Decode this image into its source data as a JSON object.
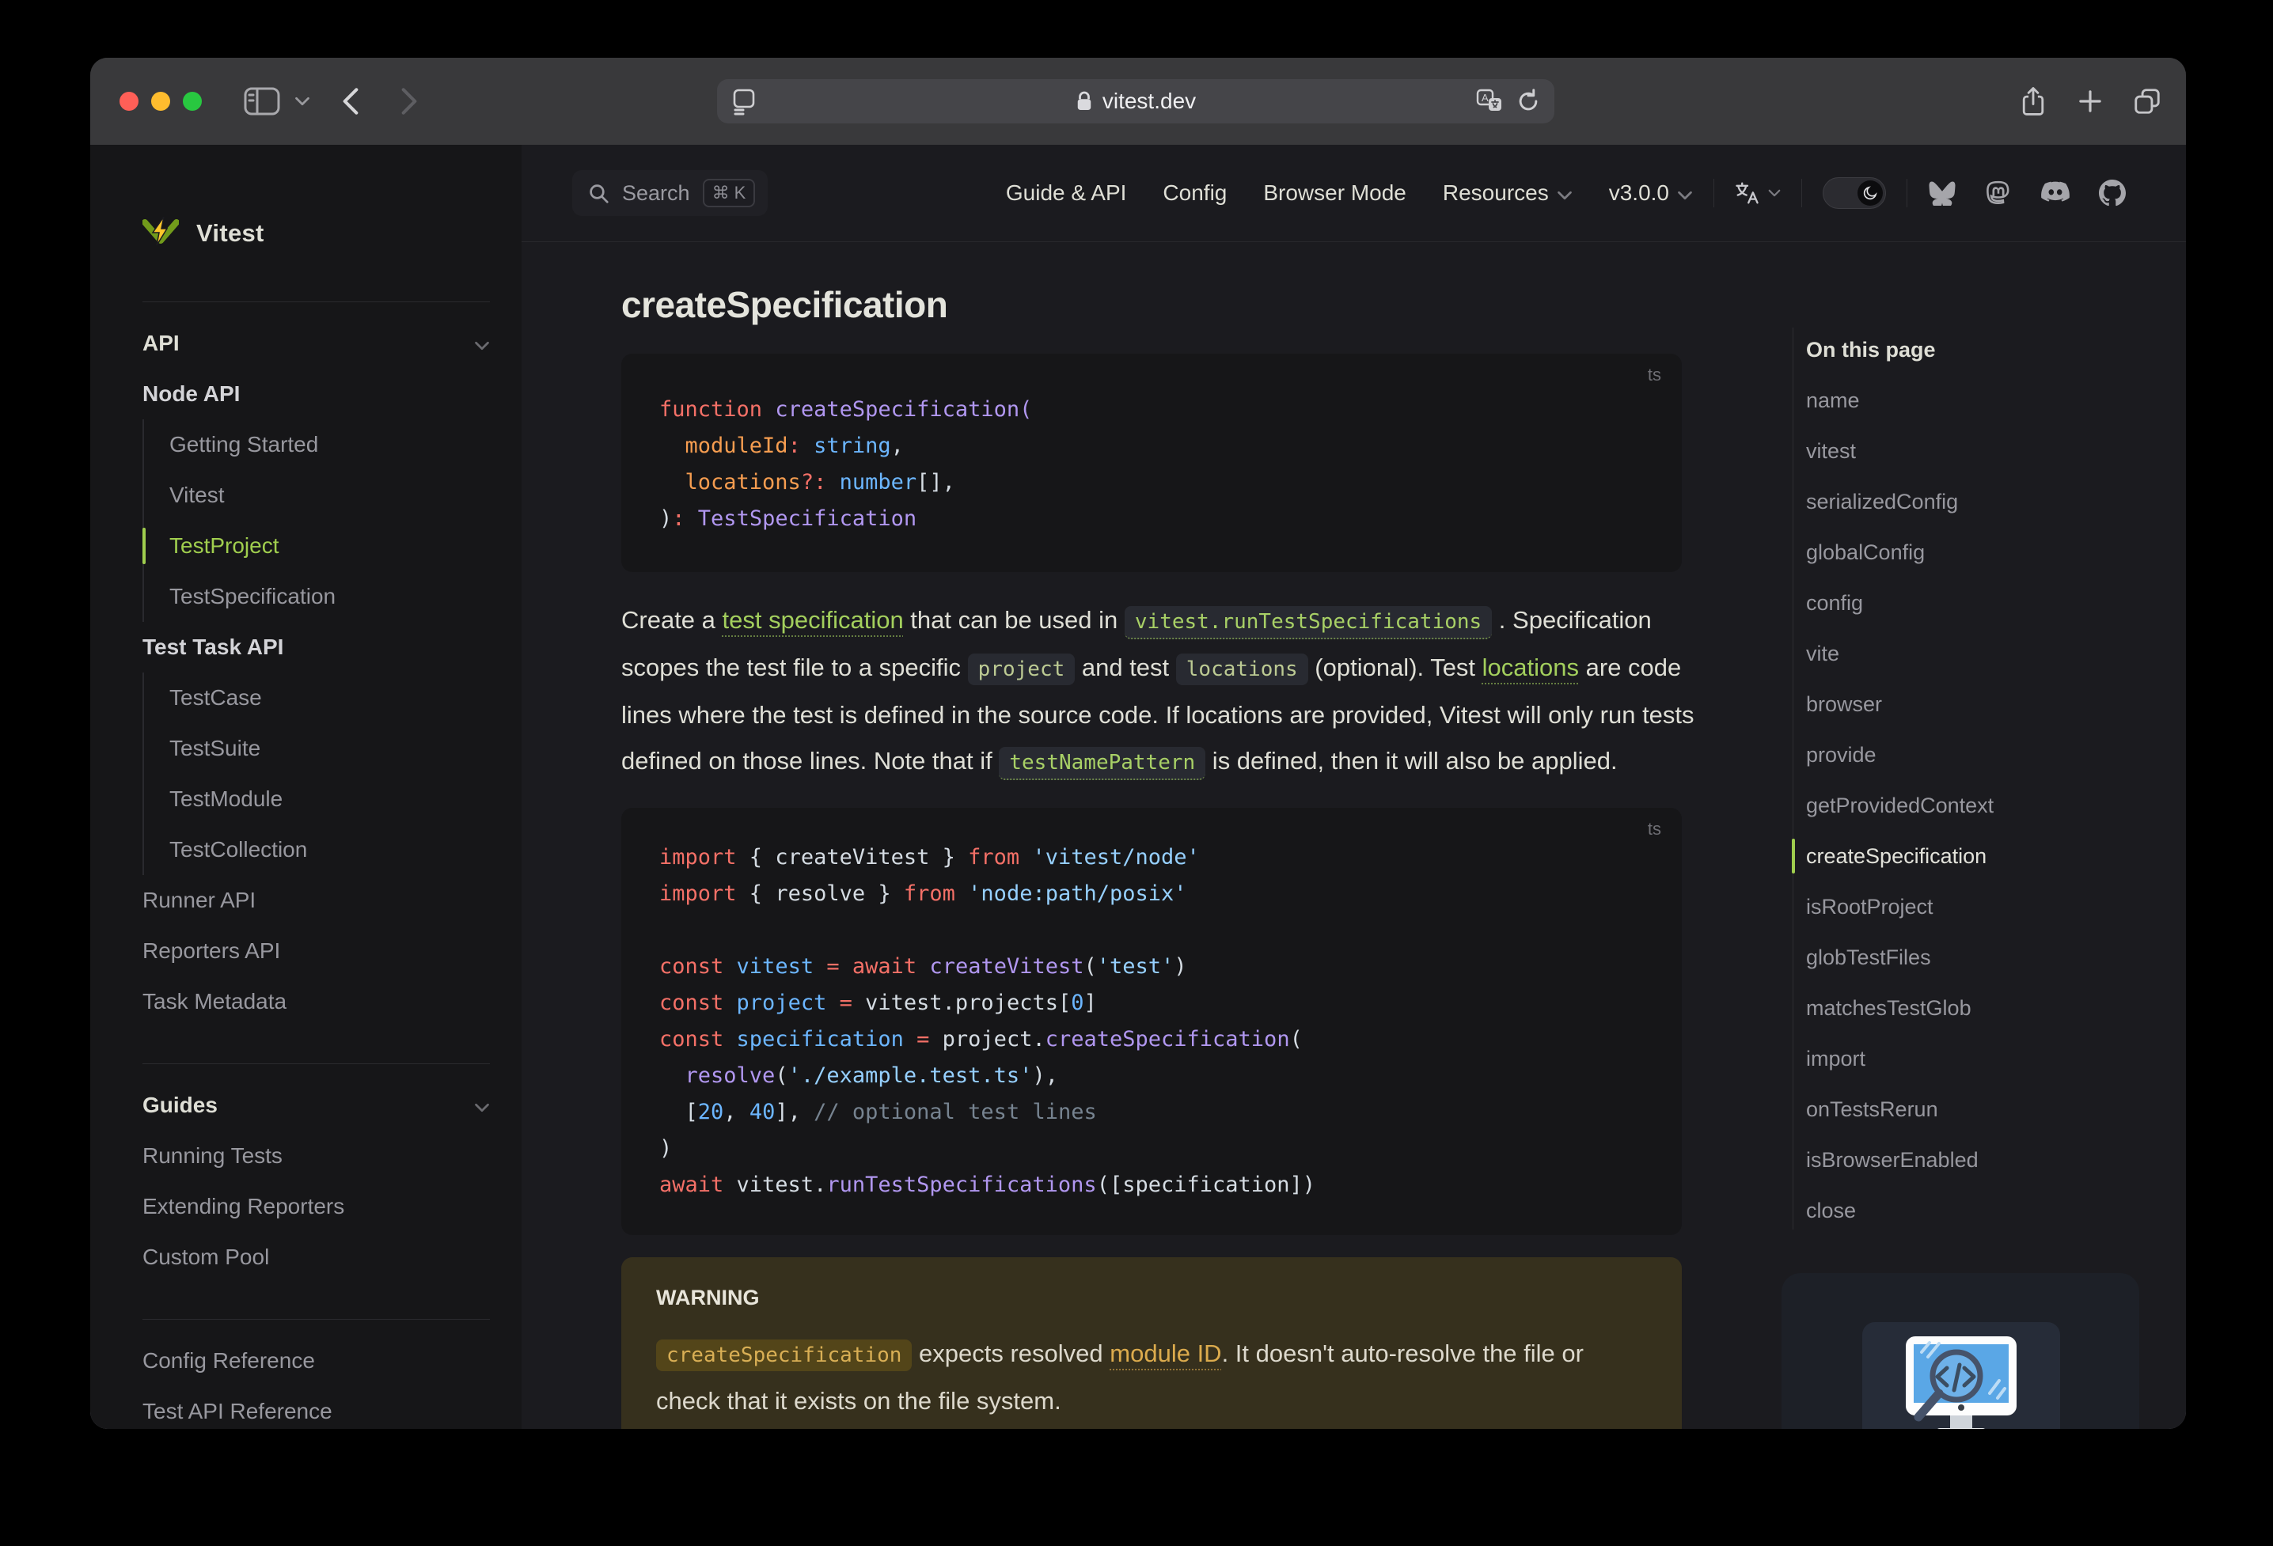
{
  "browser": {
    "url": "vitest.dev",
    "traffic_colors": {
      "red": "#ff5f57",
      "yellow": "#febc2e",
      "green": "#28c840"
    }
  },
  "nav": {
    "search_label": "Search",
    "search_kbd": "⌘ K",
    "links": [
      {
        "label": "Guide & API",
        "chevron": false
      },
      {
        "label": "Config",
        "chevron": false
      },
      {
        "label": "Browser Mode",
        "chevron": false
      },
      {
        "label": "Resources",
        "chevron": true
      },
      {
        "label": "v3.0.0",
        "chevron": true
      }
    ],
    "social_icons": [
      "bluesky-icon",
      "mastodon-icon",
      "discord-icon",
      "github-icon"
    ]
  },
  "sidebar": {
    "logo_text": "Vitest",
    "rows": [
      {
        "t": "group",
        "label": "API"
      },
      {
        "t": "section",
        "label": "Node API"
      },
      {
        "t": "item",
        "label": "Getting Started"
      },
      {
        "t": "item",
        "label": "Vitest"
      },
      {
        "t": "item",
        "label": "TestProject",
        "active": true
      },
      {
        "t": "item",
        "label": "TestSpecification"
      },
      {
        "t": "section",
        "label": "Test Task API"
      },
      {
        "t": "item",
        "label": "TestCase"
      },
      {
        "t": "item",
        "label": "TestSuite"
      },
      {
        "t": "item",
        "label": "TestModule"
      },
      {
        "t": "item",
        "label": "TestCollection"
      },
      {
        "t": "link",
        "label": "Runner API"
      },
      {
        "t": "link",
        "label": "Reporters API"
      },
      {
        "t": "link",
        "label": "Task Metadata"
      },
      {
        "t": "divider"
      },
      {
        "t": "group",
        "label": "Guides"
      },
      {
        "t": "link",
        "label": "Running Tests"
      },
      {
        "t": "link",
        "label": "Extending Reporters"
      },
      {
        "t": "link",
        "label": "Custom Pool"
      },
      {
        "t": "divider"
      },
      {
        "t": "link",
        "label": "Config Reference"
      },
      {
        "t": "link",
        "label": "Test API Reference"
      }
    ]
  },
  "doc": {
    "h1": "createSpecification",
    "code_blocks": [
      {
        "lang": "ts",
        "lines": [
          [
            [
              "kw",
              "function"
            ],
            [
              "pl",
              " "
            ],
            [
              "fn",
              "createSpecification("
            ]
          ],
          [
            [
              "pl",
              "  "
            ],
            [
              "pr",
              "moduleId"
            ],
            [
              "op",
              ":"
            ],
            [
              "pl",
              " "
            ],
            [
              "va",
              "string"
            ],
            [
              "pl",
              ","
            ]
          ],
          [
            [
              "pl",
              "  "
            ],
            [
              "pr",
              "locations"
            ],
            [
              "op",
              "?:"
            ],
            [
              "pl",
              " "
            ],
            [
              "va",
              "number"
            ],
            [
              "pl",
              "[],"
            ]
          ],
          [
            [
              "pl",
              ")"
            ],
            [
              "op",
              ":"
            ],
            [
              "pl",
              " "
            ],
            [
              "ty",
              "TestSpecification"
            ]
          ]
        ]
      },
      {
        "lang": "ts",
        "lines": [
          [
            [
              "kw",
              "import"
            ],
            [
              "pl",
              " { createVitest } "
            ],
            [
              "kw",
              "from"
            ],
            [
              "pl",
              " "
            ],
            [
              "st",
              "'vitest/node'"
            ]
          ],
          [
            [
              "kw",
              "import"
            ],
            [
              "pl",
              " { resolve } "
            ],
            [
              "kw",
              "from"
            ],
            [
              "pl",
              " "
            ],
            [
              "st",
              "'node:path/posix'"
            ]
          ],
          [],
          [
            [
              "kw",
              "const"
            ],
            [
              "pl",
              " "
            ],
            [
              "va",
              "vitest"
            ],
            [
              "pl",
              " "
            ],
            [
              "op",
              "="
            ],
            [
              "pl",
              " "
            ],
            [
              "kw",
              "await"
            ],
            [
              "pl",
              " "
            ],
            [
              "fn",
              "createVitest"
            ],
            [
              "pl",
              "("
            ],
            [
              "st",
              "'test'"
            ],
            [
              "pl",
              ")"
            ]
          ],
          [
            [
              "kw",
              "const"
            ],
            [
              "pl",
              " "
            ],
            [
              "va",
              "project"
            ],
            [
              "pl",
              " "
            ],
            [
              "op",
              "="
            ],
            [
              "pl",
              " vitest.projects["
            ],
            [
              "nu",
              "0"
            ],
            [
              "pl",
              "]"
            ]
          ],
          [
            [
              "kw",
              "const"
            ],
            [
              "pl",
              " "
            ],
            [
              "va",
              "specification"
            ],
            [
              "pl",
              " "
            ],
            [
              "op",
              "="
            ],
            [
              "pl",
              " project."
            ],
            [
              "fn",
              "createSpecification"
            ],
            [
              "pl",
              "("
            ]
          ],
          [
            [
              "pl",
              "  "
            ],
            [
              "fn",
              "resolve"
            ],
            [
              "pl",
              "("
            ],
            [
              "st",
              "'./example.test.ts'"
            ],
            [
              "pl",
              "),"
            ]
          ],
          [
            [
              "pl",
              "  ["
            ],
            [
              "nu",
              "20"
            ],
            [
              "pl",
              ", "
            ],
            [
              "nu",
              "40"
            ],
            [
              "pl",
              "], "
            ],
            [
              "cm",
              "// optional test lines"
            ]
          ],
          [
            [
              "pl",
              ")"
            ]
          ],
          [
            [
              "kw",
              "await"
            ],
            [
              "pl",
              " vitest."
            ],
            [
              "fn",
              "runTestSpecifications"
            ],
            [
              "pl",
              "([specification])"
            ]
          ]
        ]
      }
    ],
    "paragraph": [
      {
        "k": "text",
        "t": "Create a "
      },
      {
        "k": "link",
        "t": "test specification"
      },
      {
        "k": "text",
        "t": " that can be used in "
      },
      {
        "k": "codelink",
        "t": "vitest.runTestSpecifications"
      },
      {
        "k": "text",
        "t": " . Specification scopes the test file to a specific "
      },
      {
        "k": "code",
        "t": "project"
      },
      {
        "k": "text",
        "t": " and test "
      },
      {
        "k": "code",
        "t": "locations"
      },
      {
        "k": "text",
        "t": " (optional). Test "
      },
      {
        "k": "link",
        "t": "locations"
      },
      {
        "k": "text",
        "t": " are code lines where the test is defined in the source code. If locations are provided, Vitest will only run tests defined on those lines. Note that if "
      },
      {
        "k": "codelink",
        "t": "testNamePattern"
      },
      {
        "k": "text",
        "t": " is defined, then it will also be applied."
      }
    ],
    "warning": {
      "title": "WARNING",
      "segments": [
        {
          "k": "wcode",
          "t": "createSpecification"
        },
        {
          "k": "text",
          "t": " expects resolved "
        },
        {
          "k": "wlink",
          "t": "module ID"
        },
        {
          "k": "text",
          "t": ". It doesn't auto-resolve the file or check that it exists on the file system."
        }
      ]
    }
  },
  "aside": {
    "title": "On this page",
    "items": [
      {
        "label": "name"
      },
      {
        "label": "vitest"
      },
      {
        "label": "serializedConfig"
      },
      {
        "label": "globalConfig"
      },
      {
        "label": "config"
      },
      {
        "label": "vite"
      },
      {
        "label": "browser"
      },
      {
        "label": "provide"
      },
      {
        "label": "getProvidedContext"
      },
      {
        "label": "createSpecification",
        "active": true
      },
      {
        "label": "isRootProject"
      },
      {
        "label": "globTestFiles"
      },
      {
        "label": "matchesTestGlob"
      },
      {
        "label": "import"
      },
      {
        "label": "onTestsRerun"
      },
      {
        "label": "isBrowserEnabled"
      },
      {
        "label": "close"
      }
    ]
  },
  "colors": {
    "brand_green": "#a0ce4e",
    "link_green": "#a3cf5d",
    "warning_accent": "#d9af55",
    "traffic_red": "#ff5f57",
    "traffic_yellow": "#febc2e",
    "traffic_green": "#28c840"
  }
}
